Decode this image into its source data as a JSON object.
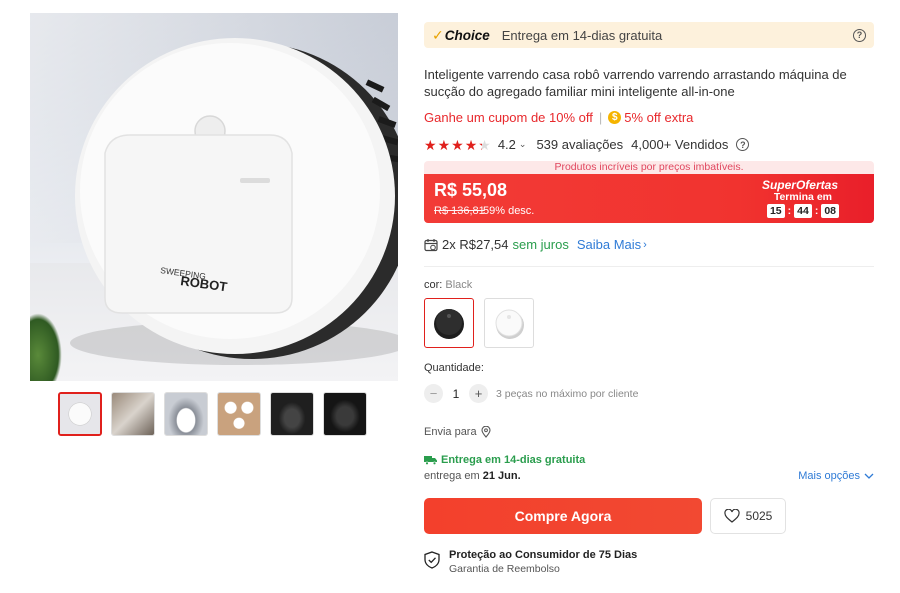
{
  "gallery": {
    "robot_brand_line1": "SWEEPING",
    "robot_brand_line2": "ROBOT",
    "thumbnails": [
      "thumb-1",
      "thumb-2",
      "thumb-3",
      "thumb-4",
      "thumb-5",
      "thumb-6"
    ],
    "active_thumbnail": 0
  },
  "choice": {
    "logo": "Choice",
    "delivery_text": "Entrega em 14-dias gratuita",
    "help_icon": "question-circle-icon"
  },
  "product": {
    "title": "Inteligente varrendo casa robô varrendo varrendo arrastando máquina de sucção do agregado familiar mini inteligente all-in-one"
  },
  "promo": {
    "coupon": "Ganhe um cupom de 10% off",
    "separator": "|",
    "coin_icon": "coin-icon",
    "extra": "5% off extra"
  },
  "rating": {
    "value": "4.2",
    "stars": 4.2,
    "reviews": "539 avaliações",
    "sold": "4,000+ Vendidos"
  },
  "price": {
    "banner": "Produtos incríveis por preços imbatíveis.",
    "current": "R$ 55,08",
    "original": "R$ 136,81",
    "discount": "59% desc.",
    "super_ofertas": "SuperOfertas",
    "ends_in": "Termina em",
    "timer": {
      "h": "15",
      "m": "44",
      "s": "08"
    }
  },
  "installment": {
    "text": "2x R$27,54",
    "no_interest": "sem juros",
    "link": "Saiba Mais"
  },
  "color": {
    "label": "cor:",
    "selected": "Black",
    "options": [
      "Black",
      "White"
    ]
  },
  "quantity": {
    "label": "Quantidade:",
    "value": "1",
    "minus": "−",
    "plus": "+",
    "note": "3 peças no máximo por cliente"
  },
  "shipping": {
    "label": "Envia para",
    "free": "Entrega em 14-dias gratuita",
    "delivery_prefix": "entrega em",
    "delivery_date": "21 Jun.",
    "more_options": "Mais opções"
  },
  "actions": {
    "buy": "Compre Agora",
    "wishlist_count": "5025"
  },
  "protection": {
    "title": "Proteção ao Consumidor de 75 Dias",
    "subtitle": "Garantia de Reembolso"
  },
  "colors": {
    "accent_red": "#e0201c",
    "green": "#2a9d4d",
    "link_blue": "#2f7bd6",
    "choice_bg": "#fdf1dc"
  }
}
